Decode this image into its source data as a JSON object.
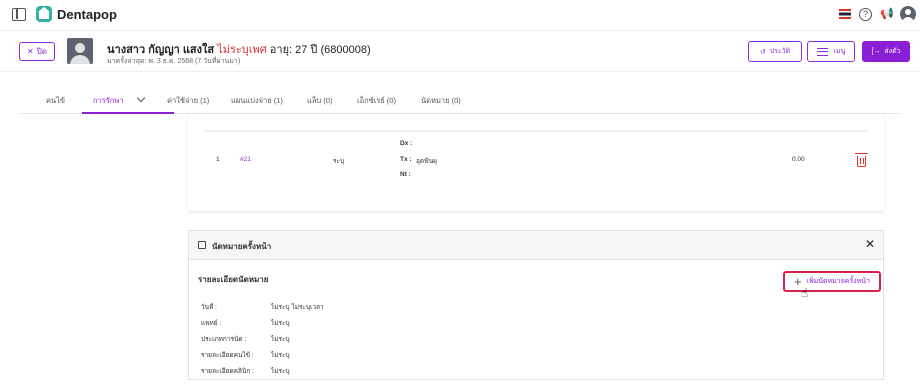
{
  "app": {
    "brand": "Dentapop"
  },
  "patient": {
    "close_label": "ปิด",
    "name": "นางสาว กัญญา แสงใส",
    "gender": "ไม่ระบุเพศ",
    "age": "อายุ: 27 ปี (6800008)",
    "last_visit": "มาครั้งล่าสุด: พ. 3 ธ.ค. 2568 (7 วันที่ผ่านมา)",
    "history_label": "ประวัติ",
    "menu_label": "เมนู",
    "send_label": "ส่งตัว"
  },
  "tabs": [
    {
      "label": "คนไข้"
    },
    {
      "label": "การรักษา"
    },
    {
      "label": "ค่าใช้จ่าย (1)"
    },
    {
      "label": "แผนแบ่งจ่าย (1)"
    },
    {
      "label": "แล็บ (0)"
    },
    {
      "label": "เอ็กซ์เรย์ (0)"
    },
    {
      "label": "นัดหมาย (0)"
    }
  ],
  "treatment_row": {
    "index": "1",
    "tooth": "#21",
    "area": "ระบุ",
    "dx_label": "Dx :",
    "tx_label": "Tx :",
    "tx_value": "อุดฟันผุ",
    "nt_label": "Nt :",
    "amount": "0.00"
  },
  "appointment": {
    "title": "นัดหมายครั้งหน้า",
    "subtitle": "รายละเอียดนัดหมาย",
    "add_button": "เพิ่มนัดหมายครั้งหน้า",
    "fields": [
      {
        "label": "วันที่ :",
        "value": "ไม่ระบุ  ไม่ระบุเวลา"
      },
      {
        "label": "แพทย์ :",
        "value": "ไม่ระบุ"
      },
      {
        "label": "ประเภทการนัด :",
        "value": "ไม่ระบุ"
      },
      {
        "label": "รายละเอียดคนไข้ :",
        "value": "ไม่ระบุ"
      },
      {
        "label": "รายละเอียดคลินิก :",
        "value": "ไม่ระบุ"
      }
    ]
  },
  "colors": {
    "accent": "#8a1fd6",
    "danger": "#d33333",
    "highlight_border": "#d8204a"
  }
}
